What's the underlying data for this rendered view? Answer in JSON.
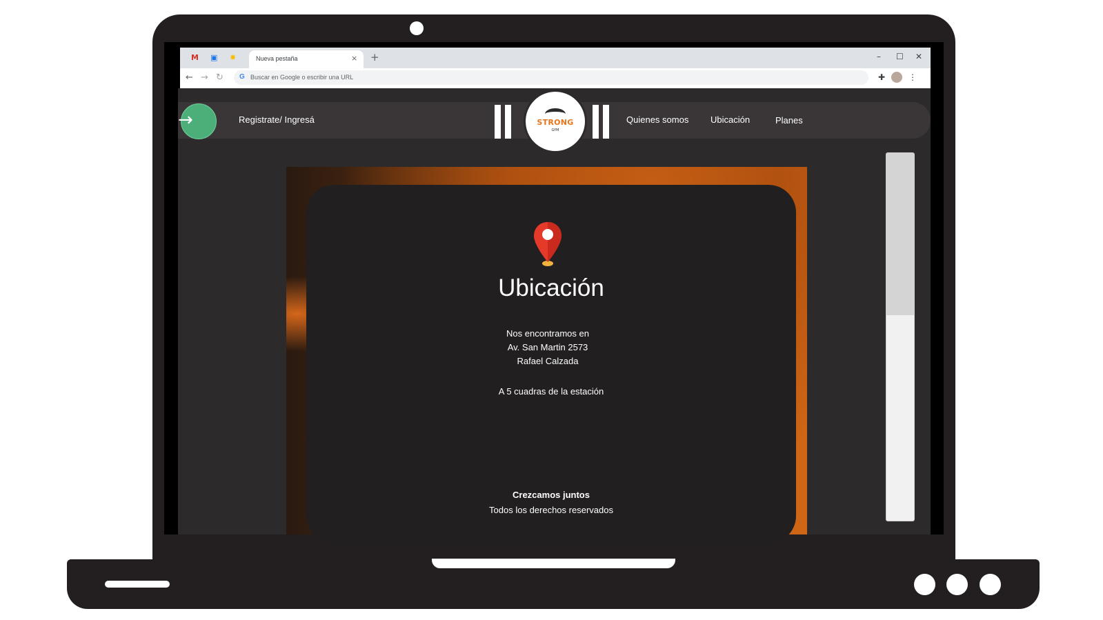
{
  "browser": {
    "tabs": [
      {
        "icon": "gmail-icon",
        "glyph": "M"
      },
      {
        "icon": "calendar-icon",
        "glyph": "▣"
      },
      {
        "icon": "photos-icon",
        "glyph": "✸"
      }
    ],
    "active_tab_title": "Nueva pestaña",
    "tab_close": "×",
    "new_tab": "+",
    "window_controls": {
      "minimize": "–",
      "maximize": "☐",
      "close": "✕"
    },
    "nav": {
      "back": "←",
      "forward": "→",
      "reload": "↻"
    },
    "omnibox_prefix": "G",
    "omnibox_placeholder": "Buscar en Google o escribir una URL",
    "toolbar_icons": {
      "extensions": "✚",
      "menu": "⋮"
    }
  },
  "site": {
    "login_arrow": "→",
    "login_label": "Registrate/ Ingresá",
    "logo_text": "STRONG",
    "logo_sub": "GYM",
    "nav_items": [
      "Quienes somos",
      "Ubicación",
      "Planes"
    ],
    "card": {
      "title": "Ubicación",
      "address_lines": [
        "Nos encontramos en",
        "Av. San Martin 2573",
        "Rafael Calzada"
      ],
      "note": "A 5 cuadras de la estación",
      "footer_title": "Crezcamos juntos",
      "footer_rights": "Todos los derechos reservados"
    }
  },
  "colors": {
    "accent_green": "#4caf7a",
    "brand_orange": "#e8751a",
    "pin_red": "#e53a2a",
    "page_bg": "#2d2a2b",
    "card_bg": "#221f20"
  }
}
